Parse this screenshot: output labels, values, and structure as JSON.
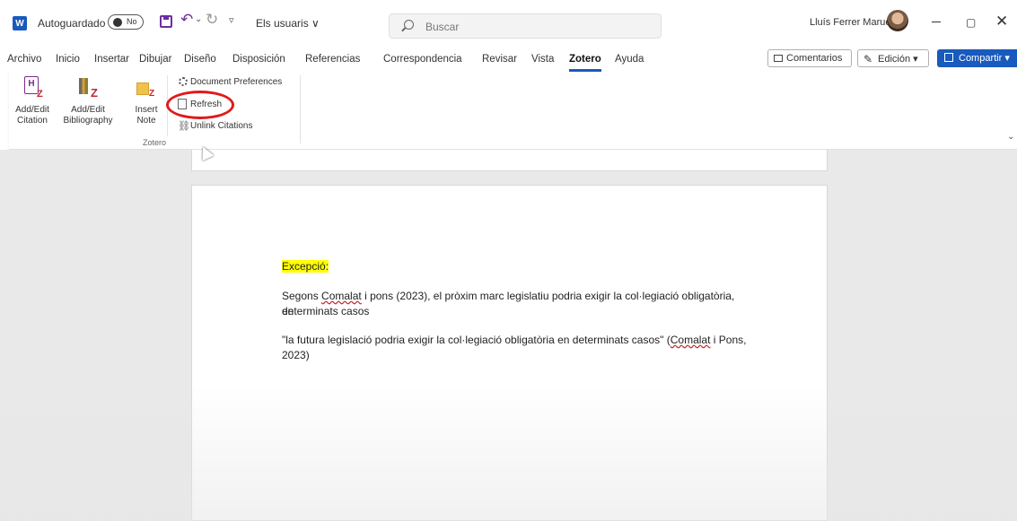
{
  "titlebar": {
    "app_icon_letter": "W",
    "autosave_label": "Autoguardado",
    "autosave_state": "No",
    "document_name": "Els usuaris ∨",
    "search_placeholder": "Buscar",
    "user_name": "Lluís Ferrer Maruenda",
    "minimize_glyph": "—",
    "maximize_glyph": "▢",
    "close_glyph": "✕"
  },
  "ribbon_tabs": [
    {
      "label": "Archivo"
    },
    {
      "label": "Inicio"
    },
    {
      "label": "Insertar"
    },
    {
      "label": "Dibujar"
    },
    {
      "label": "Diseño"
    },
    {
      "label": "Disposición"
    },
    {
      "label": "Referencias"
    },
    {
      "label": "Correspondencia"
    },
    {
      "label": "Revisar"
    },
    {
      "label": "Vista"
    },
    {
      "label": "Zotero"
    },
    {
      "label": "Ayuda"
    }
  ],
  "active_tab": "Zotero",
  "actions": {
    "comments_label": "Comentarios",
    "editing_label": "Edición ▾",
    "share_label": "Compartir ▾"
  },
  "zotero_group": {
    "add_citation_line1": "Add/Edit",
    "add_citation_line2": "Citation",
    "add_bibliography_line1": "Add/Edit",
    "add_bibliography_line2": "Bibliography",
    "insert_note_line1": "Insert",
    "insert_note_line2": "Note",
    "document_preferences": "Document Preferences",
    "refresh": "Refresh",
    "unlink_citations": "Unlink Citations",
    "group_label": "Zotero"
  },
  "document": {
    "heading": "Excepció:",
    "p1_before": "Segons ",
    "p1_name": "Comalat",
    "p1_after": " i pons (2023), el pròxim marc legislatiu podria exigir la col·legiació obligatòria, en",
    "p1_line2": "determinats casos",
    "p2_before": "\"la futura legislació podria exigir la col·legiació obligatòria en determinats casos\" (",
    "p2_name": "Comalat",
    "p2_after": " i Pons,",
    "p2_line2": "2023)"
  },
  "colors": {
    "word_blue": "#185abd",
    "highlight_yellow": "#ffff00",
    "annotation_red": "#e01a1a"
  }
}
